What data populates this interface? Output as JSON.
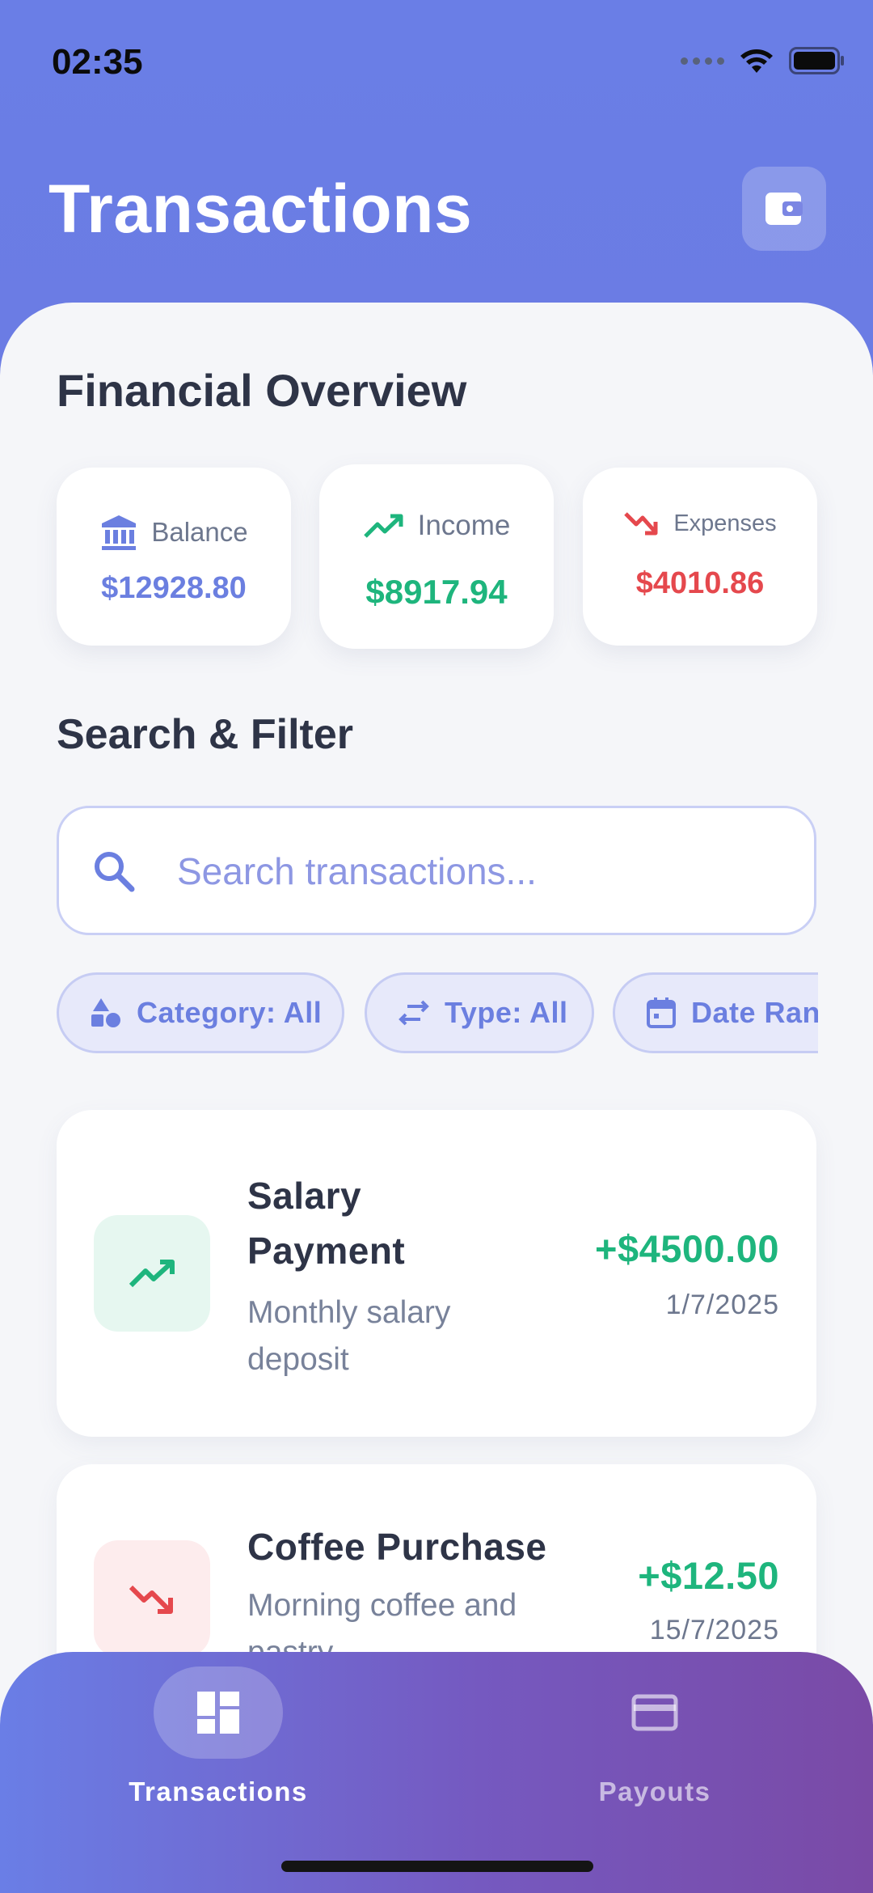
{
  "status_bar": {
    "time": "02:35"
  },
  "header": {
    "title": "Transactions",
    "wallet_icon": "wallet-icon"
  },
  "overview": {
    "title": "Financial Overview",
    "cards": [
      {
        "label": "Balance",
        "value": "$12928.80",
        "icon": "bank-icon",
        "color": "#6b7fe0"
      },
      {
        "label": "Income",
        "value": "$8917.94",
        "icon": "trending-up-icon",
        "color": "#1eb57d"
      },
      {
        "label": "Expenses",
        "value": "$4010.86",
        "icon": "trending-down-icon",
        "color": "#e5484d"
      }
    ]
  },
  "filter": {
    "title": "Search & Filter",
    "search_placeholder": "Search transactions...",
    "chips": [
      {
        "label": "Category: All",
        "icon": "category-icon"
      },
      {
        "label": "Type: All",
        "icon": "swap-icon"
      },
      {
        "label": "Date Ran",
        "icon": "calendar-icon"
      }
    ]
  },
  "transactions": [
    {
      "title_line1": "Salary",
      "title_line2": "Payment",
      "desc_line1": "Monthly salary",
      "desc_line2": "deposit",
      "amount": "+$4500.00",
      "date": "1/7/2025",
      "icon": "trending-up-icon"
    },
    {
      "title": "Coffee Purchase",
      "desc_line1": "Morning coffee and",
      "desc_line2": "pastry",
      "amount": "+$12.50",
      "date": "15/7/2025",
      "icon": "trending-down-icon"
    }
  ],
  "bottom_nav": {
    "items": [
      {
        "label": "Transactions",
        "icon": "dashboard-icon",
        "active": true
      },
      {
        "label": "Payouts",
        "icon": "credit-card-icon",
        "active": false
      }
    ]
  },
  "colors": {
    "accent": "#6b7fe0",
    "income": "#1eb57d",
    "expense": "#e5484d",
    "text_dark": "#2e3447"
  }
}
